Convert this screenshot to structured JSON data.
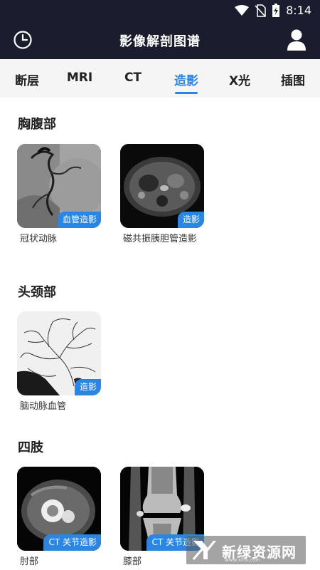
{
  "status_bar": {
    "time": "8:14"
  },
  "app": {
    "title": "影像解剖图谱"
  },
  "tabs": [
    {
      "label": "断层"
    },
    {
      "label": "MRI"
    },
    {
      "label": "CT"
    },
    {
      "label": "造影",
      "active": true
    },
    {
      "label": "X光"
    },
    {
      "label": "插图"
    }
  ],
  "sections": [
    {
      "title": "胸腹部",
      "items": [
        {
          "caption": "冠状动脉",
          "badge": "血管造影",
          "image": "coronary-angiogram"
        },
        {
          "caption": "磁共振胰胆管造影",
          "badge": "造影",
          "image": "mrcp-axial-image"
        }
      ]
    },
    {
      "title": "头颈部",
      "items": [
        {
          "caption": "脑动脉血管",
          "badge": "造影",
          "image": "cerebral-angiogram"
        }
      ]
    },
    {
      "title": "四肢",
      "items": [
        {
          "caption": "肘部",
          "badge": "CT 关节造影",
          "image": "elbow-ct-image"
        },
        {
          "caption": "膝部",
          "badge": "CT 关节造影",
          "image": "knee-ct-image"
        }
      ]
    }
  ],
  "watermark": {
    "text": "新绿资源网",
    "url": "www.xlhs.com"
  },
  "colors": {
    "header_bg": "#1b1d2e",
    "accent": "#2b86e3",
    "tab_bg": "#f5f5f5"
  }
}
